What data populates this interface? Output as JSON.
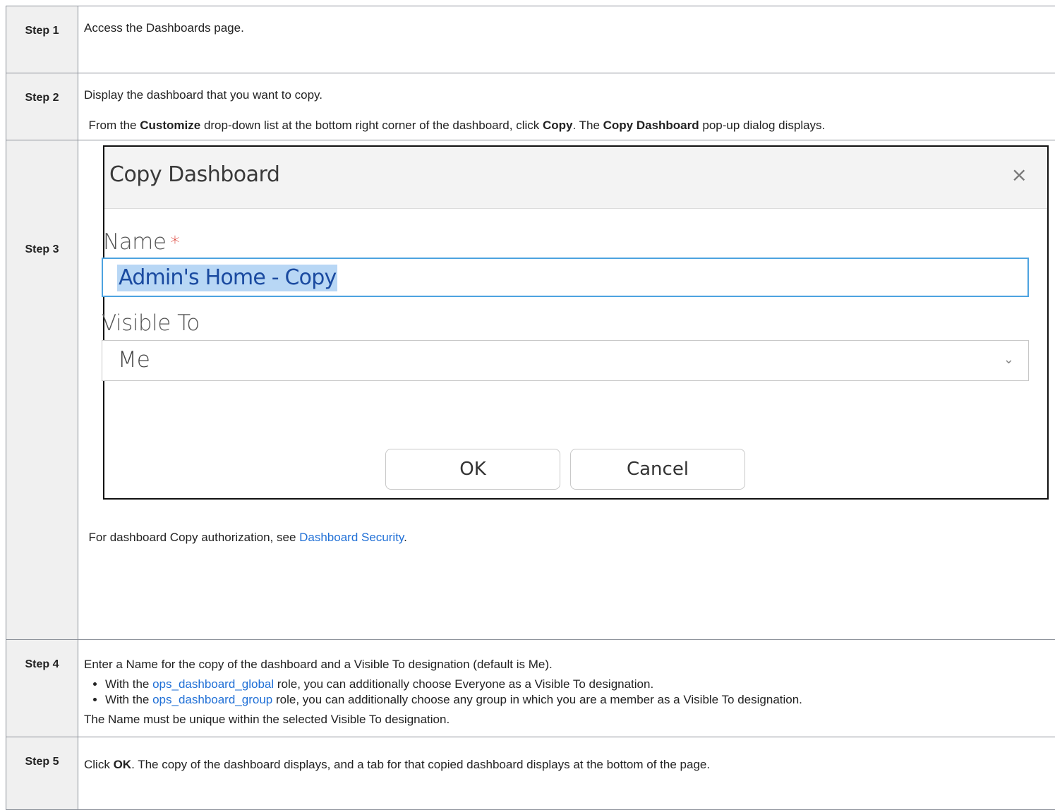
{
  "steps": [
    {
      "label": "Step 1",
      "text": "Access the Dashboards page."
    },
    {
      "label": "Step 2",
      "text": "Display the dashboard that you want to copy."
    },
    {
      "label": "Step 3",
      "t1": "From the ",
      "b1": "Customize",
      "t2": " drop-down list at the bottom right corner of the dashboard, click ",
      "b2": "Copy",
      "t3": ". The ",
      "b3": "Copy Dashboard",
      "t4": " pop-up dialog displays.",
      "note_pre": "For dashboard Copy authorization, see ",
      "note_link": "Dashboard Security",
      "note_post": "."
    },
    {
      "label": "Step 4",
      "intro": "Enter a Name for the copy of the dashboard and a Visible To designation (default is Me).",
      "bullets": [
        {
          "pre": "With the ",
          "link": "ops_dashboard_global",
          "post": " role, you can additionally choose Everyone as a Visible To designation."
        },
        {
          "pre": "With the ",
          "link": "ops_dashboard_group",
          "post": " role, you can additionally choose any group in which you are a member as a Visible To designation."
        }
      ],
      "outro": "The Name must be unique within the selected Visible To designation."
    },
    {
      "label": "Step 5",
      "t1": "Click ",
      "b1": "OK",
      "t2": ". The copy of the dashboard displays, and a tab for that copied dashboard displays at the bottom of the page."
    }
  ],
  "dialog": {
    "title": "Copy Dashboard",
    "close_glyph": "×",
    "name_label": "Name",
    "required_mark": "*",
    "name_value": "Admin's Home - Copy",
    "visible_label": "Visible To",
    "visible_value": "Me",
    "chevron_glyph": "⌄",
    "ok_label": "OK",
    "cancel_label": "Cancel"
  },
  "colors": {
    "link": "#1f6fd6",
    "focus_border": "#4da3e0",
    "selection": "#b8d7f5",
    "required": "#d93025"
  }
}
